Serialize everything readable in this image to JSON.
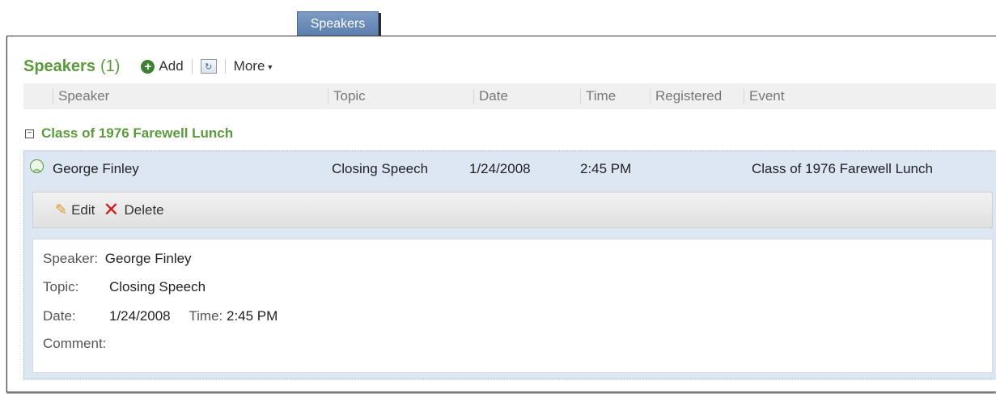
{
  "tab": {
    "label": "Speakers"
  },
  "toolbar": {
    "title": "Speakers",
    "count": "(1)",
    "add_label": "Add",
    "more_label": "More",
    "refresh_icon": "refresh-icon"
  },
  "columns": [
    "Speaker",
    "Topic",
    "Date",
    "Time",
    "Registered",
    "Event"
  ],
  "group": {
    "title": "Class of 1976 Farewell Lunch"
  },
  "record": {
    "speaker": "George Finley",
    "topic": "Closing Speech",
    "date": "1/24/2008",
    "time": "2:45 PM",
    "registered": "",
    "event": "Class of 1976 Farewell Lunch"
  },
  "actions": {
    "edit_label": "Edit",
    "delete_label": "Delete"
  },
  "details": {
    "speaker_label": "Speaker:",
    "speaker_value": "George Finley",
    "topic_label": "Topic:",
    "topic_value": "Closing Speech",
    "date_label": "Date:",
    "date_value": "1/24/2008",
    "time_label": "Time:",
    "time_value": "2:45 PM",
    "comment_label": "Comment:"
  },
  "colors": {
    "accent_green": "#5a9a3c",
    "tab_blue": "#6a8cb8",
    "row_selected": "#dde7f3",
    "delete_red": "#d01a1a"
  }
}
